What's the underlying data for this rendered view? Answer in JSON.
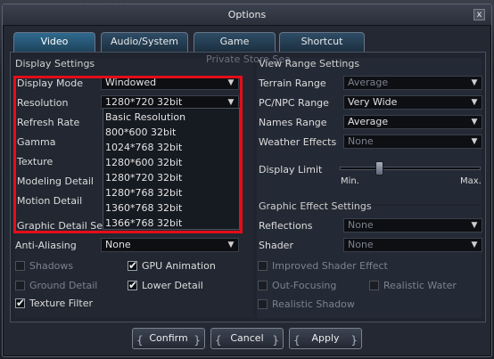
{
  "window": {
    "title": "Options",
    "close_label": "x"
  },
  "background_text": "Private Store Sea",
  "tabs": [
    "Video",
    "Audio/System",
    "Game",
    "Shortcut"
  ],
  "display": {
    "title": "Display Settings",
    "labels": {
      "mode": "Display Mode",
      "resolution": "Resolution",
      "refresh": "Refresh Rate",
      "gamma": "Gamma",
      "texture": "Texture",
      "modeling": "Modeling Detail",
      "motion": "Motion Detail",
      "graphic_detail": "Graphic Detail Settings",
      "anti_aliasing": "Anti-Aliasing"
    },
    "values": {
      "mode": "Windowed",
      "resolution": "1280*720 32bit",
      "anti_aliasing": "None"
    },
    "dropdown_options": [
      "Basic Resolution",
      "800*600 32bit",
      "1024*768 32bit",
      "1280*600 32bit",
      "1280*720 32bit",
      "1280*768 32bit",
      "1360*768 32bit",
      "1366*768 32bit"
    ],
    "checks": {
      "shadows": "Shadows",
      "gpu_animation": "GPU Animation",
      "ground_detail": "Ground Detail",
      "lower_detail": "Lower Detail",
      "texture_filter": "Texture Filter"
    }
  },
  "view_range": {
    "title": "View Range Settings",
    "labels": {
      "terrain": "Terrain Range",
      "pcnpc": "PC/NPC Range",
      "names": "Names Range",
      "weather": "Weather Effects",
      "display_limit": "Display Limit"
    },
    "values": {
      "terrain": "Average",
      "pcnpc": "Very Wide",
      "names": "Average",
      "weather": "None"
    },
    "slider": {
      "min_label": "Min.",
      "max_label": "Max.",
      "level": 0.27
    }
  },
  "graphic_effects": {
    "title": "Graphic Effect Settings",
    "labels": {
      "reflections": "Reflections",
      "shader": "Shader"
    },
    "values": {
      "reflections": "None",
      "shader": "None"
    },
    "checks": {
      "improved_shader": "Improved Shader Effect",
      "out_focusing": "Out-Focusing",
      "realistic_water": "Realistic Water",
      "realistic_shadow": "Realistic Shadow"
    }
  },
  "buttons": {
    "confirm": "Confirm",
    "cancel": "Cancel",
    "apply": "Apply"
  },
  "colors": {
    "highlight": "#e40d18",
    "tab_active": "#2f6a8e"
  },
  "icons": {
    "close": "close-icon",
    "dropdown": "chevron-down-icon",
    "check": "checkmark-icon"
  }
}
